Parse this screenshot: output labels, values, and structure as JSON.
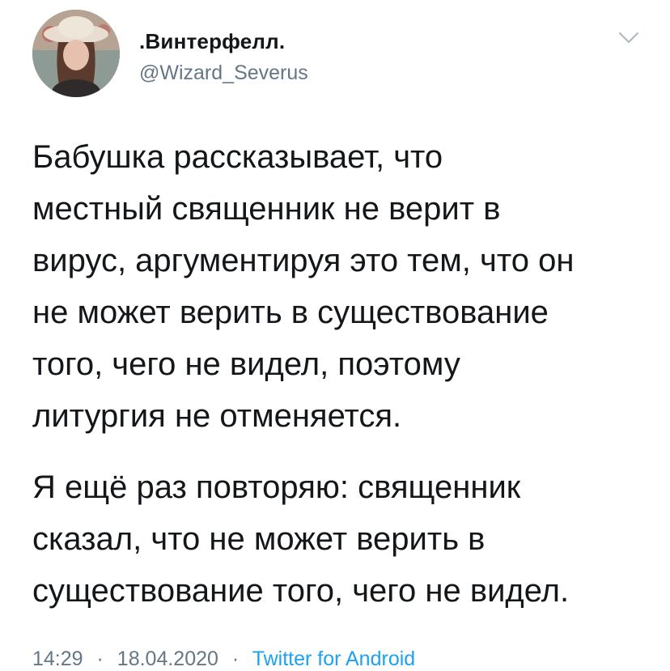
{
  "tweet": {
    "author": {
      "display_name": ".Винтерфелл.",
      "handle": "@Wizard_Severus"
    },
    "body": {
      "paragraph1_lines": [
        "Бабушка рассказывает, что",
        "местный священник не верит в",
        "вирус, аргументируя это тем, что он",
        "не может верить в существование",
        "того, чего не видел, поэтому",
        "литургия не отменяется."
      ],
      "paragraph2_lines": [
        "Я ещё раз повторяю: священник",
        "сказал, что не может верить в",
        "существование того, чего не видел."
      ]
    },
    "meta": {
      "time": "14:29",
      "separator": "·",
      "date": "18.04.2020",
      "source": "Twitter for Android"
    },
    "icons": {
      "menu": "chevron-down-icon",
      "avatar": "avatar"
    },
    "colors": {
      "text": "#14171a",
      "secondary": "#657786",
      "link": "#1da1f2"
    }
  }
}
